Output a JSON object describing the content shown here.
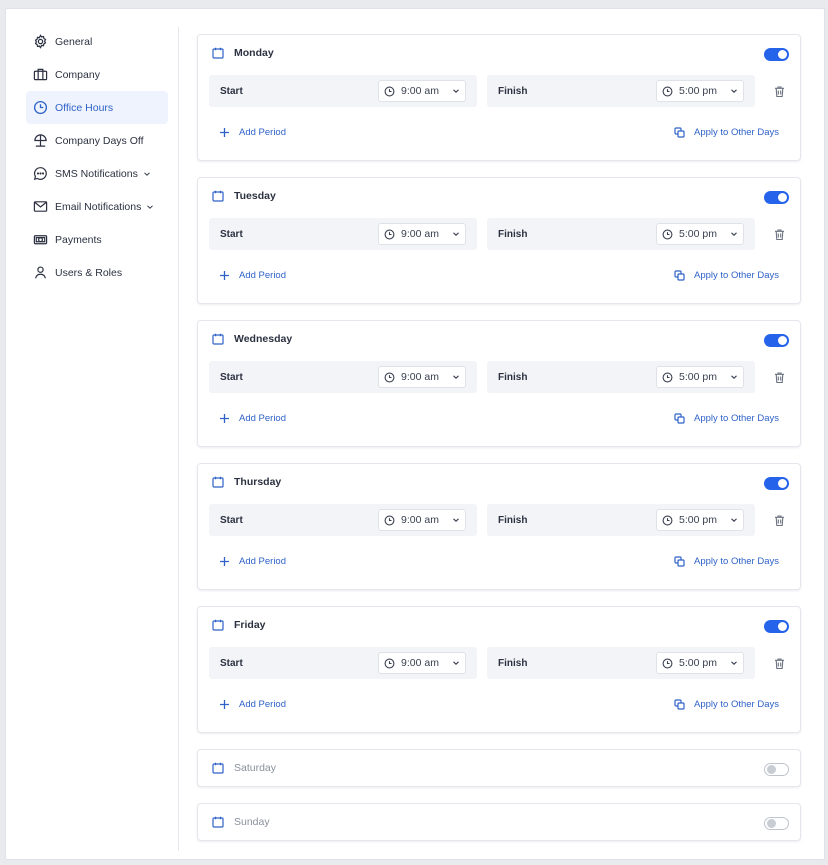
{
  "sidebar": {
    "items": [
      {
        "label": "General",
        "icon": "gear-icon"
      },
      {
        "label": "Company",
        "icon": "briefcase-icon"
      },
      {
        "label": "Office Hours",
        "icon": "clock-icon",
        "active": true
      },
      {
        "label": "Company Days Off",
        "icon": "beach-umbrella-icon"
      },
      {
        "label": "SMS Notifications",
        "icon": "chat-bubble-icon",
        "expandable": true
      },
      {
        "label": "Email Notifications",
        "icon": "envelope-icon",
        "expandable": true
      },
      {
        "label": "Payments",
        "icon": "cash-icon"
      },
      {
        "label": "Users & Roles",
        "icon": "user-icon"
      }
    ]
  },
  "labels": {
    "start": "Start",
    "finish": "Finish",
    "add_period": "Add Period",
    "apply_other_days": "Apply to Other Days"
  },
  "days": [
    {
      "name": "Monday",
      "enabled": true,
      "start": "9:00 am",
      "finish": "5:00 pm"
    },
    {
      "name": "Tuesday",
      "enabled": true,
      "start": "9:00 am",
      "finish": "5:00 pm"
    },
    {
      "name": "Wednesday",
      "enabled": true,
      "start": "9:00 am",
      "finish": "5:00 pm"
    },
    {
      "name": "Thursday",
      "enabled": true,
      "start": "9:00 am",
      "finish": "5:00 pm"
    },
    {
      "name": "Friday",
      "enabled": true,
      "start": "9:00 am",
      "finish": "5:00 pm"
    },
    {
      "name": "Saturday",
      "enabled": false
    },
    {
      "name": "Sunday",
      "enabled": false
    }
  ],
  "colors": {
    "accent": "#2563eb",
    "link": "#2f62c8",
    "active_bg": "#eef3fd"
  }
}
